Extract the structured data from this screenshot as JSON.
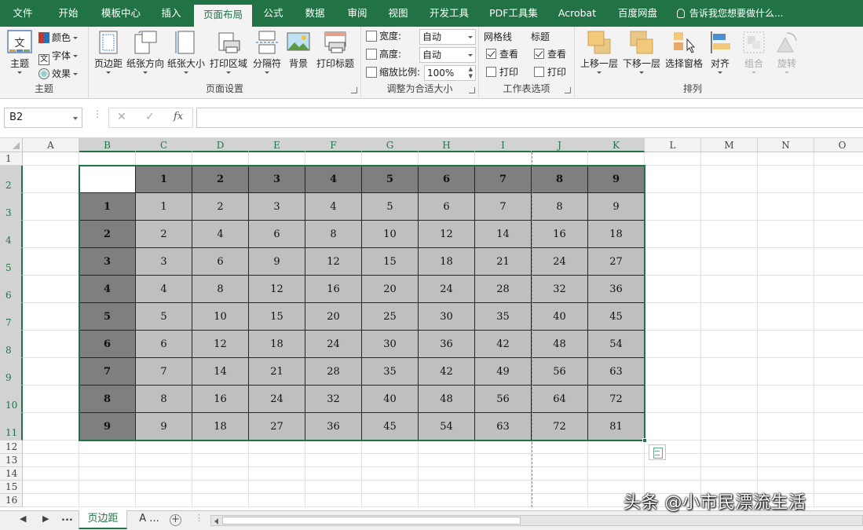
{
  "ribbon_tabs": [
    "文件",
    "开始",
    "模板中心",
    "插入",
    "页面布局",
    "公式",
    "数据",
    "审阅",
    "视图",
    "开发工具",
    "PDF工具集",
    "Acrobat",
    "百度网盘"
  ],
  "active_tab": "页面布局",
  "tell_me": "告诉我您想要做什么...",
  "theme_group": {
    "label": "主题",
    "themes_label": "主题",
    "colors_label": "颜色",
    "fonts_label": "字体",
    "effects_label": "效果"
  },
  "page_setup_group": {
    "label": "页面设置",
    "margins": "页边距",
    "orientation": "纸张方向",
    "size": "纸张大小",
    "print_area": "打印区域",
    "breaks": "分隔符",
    "background": "背景",
    "print_titles": "打印标题"
  },
  "scale_group": {
    "label": "调整为合适大小",
    "width_label": "宽度:",
    "width_value": "自动",
    "height_label": "高度:",
    "height_value": "自动",
    "scale_label": "缩放比例:",
    "scale_value": "100%"
  },
  "sheet_options_group": {
    "label": "工作表选项",
    "gridlines_label": "网格线",
    "headings_label": "标题",
    "view_label": "查看",
    "print_label": "打印"
  },
  "arrange_group": {
    "label": "排列",
    "bring_forward": "上移一层",
    "send_backward": "下移一层",
    "selection_pane": "选择窗格",
    "align": "对齐",
    "group": "组合",
    "rotate": "旋转"
  },
  "formula_bar": {
    "name_box": "B2",
    "cancel": "✕",
    "enter": "✓",
    "fx": "fx",
    "formula": ""
  },
  "columns": [
    "A",
    "B",
    "C",
    "D",
    "E",
    "F",
    "G",
    "H",
    "I",
    "J",
    "K",
    "L",
    "M",
    "N",
    "O"
  ],
  "rows": [
    "1",
    "2",
    "3",
    "4",
    "5",
    "6",
    "7",
    "8",
    "9",
    "10",
    "11",
    "12",
    "13",
    "14",
    "15",
    "16"
  ],
  "table": {
    "header": [
      "",
      "1",
      "2",
      "3",
      "4",
      "5",
      "6",
      "7",
      "8",
      "9"
    ],
    "rows": [
      [
        "1",
        "1",
        "2",
        "3",
        "4",
        "5",
        "6",
        "7",
        "8",
        "9"
      ],
      [
        "2",
        "2",
        "4",
        "6",
        "8",
        "10",
        "12",
        "14",
        "16",
        "18"
      ],
      [
        "3",
        "3",
        "6",
        "9",
        "12",
        "15",
        "18",
        "21",
        "24",
        "27"
      ],
      [
        "4",
        "4",
        "8",
        "12",
        "16",
        "20",
        "24",
        "28",
        "32",
        "36"
      ],
      [
        "5",
        "5",
        "10",
        "15",
        "20",
        "25",
        "30",
        "35",
        "40",
        "45"
      ],
      [
        "6",
        "6",
        "12",
        "18",
        "24",
        "30",
        "36",
        "42",
        "48",
        "54"
      ],
      [
        "7",
        "7",
        "14",
        "21",
        "28",
        "35",
        "42",
        "49",
        "56",
        "63"
      ],
      [
        "8",
        "8",
        "16",
        "24",
        "32",
        "40",
        "48",
        "56",
        "64",
        "72"
      ],
      [
        "9",
        "9",
        "18",
        "27",
        "36",
        "45",
        "54",
        "63",
        "72",
        "81"
      ]
    ]
  },
  "sheet_tabs": {
    "nav_prev": "◀",
    "nav_next": "▶",
    "ellipsis": "...",
    "active": "页边距",
    "other": "A ...",
    "add": "+"
  },
  "watermark": "头条 @小市民漂流生活",
  "colors": {
    "accent": "#217346",
    "table_header": "#7f7f7f",
    "table_body": "#bfbfbf"
  }
}
